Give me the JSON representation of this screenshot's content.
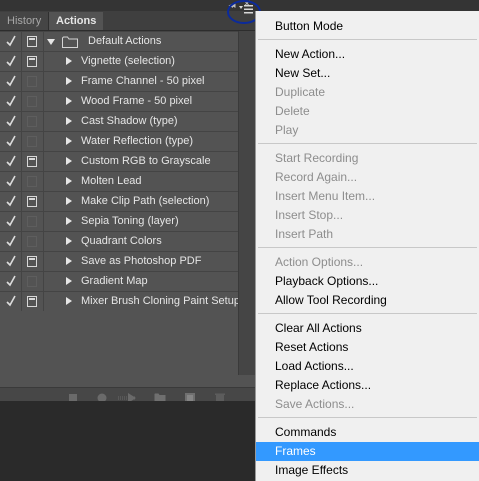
{
  "tabs": {
    "history": "History",
    "actions": "Actions"
  },
  "icons": {
    "menu": "panel-menu-icon",
    "collapse": "collapse-icon",
    "close": "close-icon",
    "folder": "folder-icon",
    "check": "check-icon",
    "dialog": "dialog-toggle-icon"
  },
  "actions_list": {
    "set_name": "Default Actions",
    "items": [
      {
        "label": "Vignette (selection)",
        "dialog": true
      },
      {
        "label": "Frame Channel - 50 pixel",
        "dialog": false
      },
      {
        "label": "Wood Frame - 50 pixel",
        "dialog": false
      },
      {
        "label": "Cast Shadow (type)",
        "dialog": false
      },
      {
        "label": "Water Reflection (type)",
        "dialog": false
      },
      {
        "label": "Custom RGB to Grayscale",
        "dialog": true
      },
      {
        "label": "Molten Lead",
        "dialog": false
      },
      {
        "label": "Make Clip Path (selection)",
        "dialog": true
      },
      {
        "label": "Sepia Toning (layer)",
        "dialog": false
      },
      {
        "label": "Quadrant Colors",
        "dialog": false
      },
      {
        "label": "Save as Photoshop PDF",
        "dialog": true
      },
      {
        "label": "Gradient Map",
        "dialog": false
      },
      {
        "label": "Mixer Brush Cloning Paint Setup",
        "dialog": true
      }
    ]
  },
  "bottom_toolbar": [
    "stop-icon",
    "record-icon",
    "play-icon",
    "new-set-icon",
    "new-action-icon",
    "delete-icon"
  ],
  "menu": {
    "button_mode": "Button Mode",
    "new_action": "New Action...",
    "new_set": "New Set...",
    "duplicate": "Duplicate",
    "delete": "Delete",
    "play": "Play",
    "start_recording": "Start Recording",
    "record_again": "Record Again...",
    "insert_menu_item": "Insert Menu Item...",
    "insert_stop": "Insert Stop...",
    "insert_path": "Insert Path",
    "action_options": "Action Options...",
    "playback_options": "Playback Options...",
    "allow_tool_recording": "Allow Tool Recording",
    "clear_all_actions": "Clear All Actions",
    "reset_actions": "Reset Actions",
    "load_actions": "Load Actions...",
    "replace_actions": "Replace Actions...",
    "save_actions": "Save Actions...",
    "commands": "Commands",
    "frames": "Frames",
    "image_effects": "Image Effects"
  },
  "colors": {
    "panel_bg": "#535353",
    "menu_bg": "#f0f0f0",
    "highlight": "#3399ff",
    "annotation_circle": "#0b2a9c"
  }
}
